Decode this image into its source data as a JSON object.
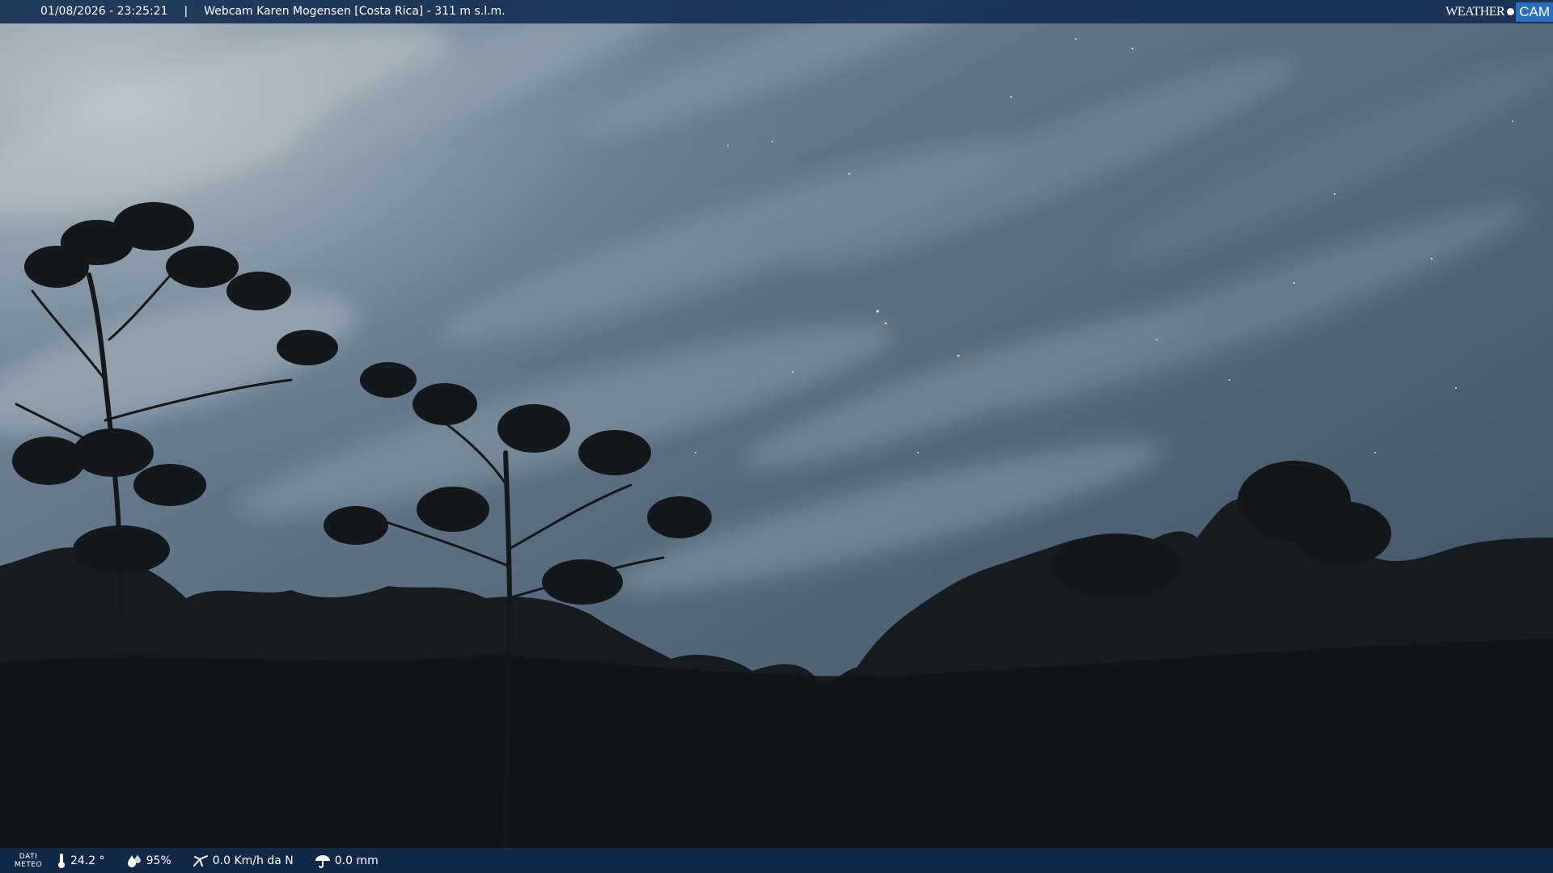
{
  "header": {
    "datetime": "01/08/2026 - 23:25:21",
    "separator": "|",
    "location": "Webcam Karen Mogensen [Costa Rica] - 311 m s.l.m."
  },
  "logo": {
    "weather": "WEATHER",
    "cam": "CAM"
  },
  "meteo": {
    "label_line1": "DATI",
    "label_line2": "METEO",
    "temperature": "24.2 °",
    "humidity": "95%",
    "wind": "0.0 Km/h da N",
    "rain": "0.0 mm"
  },
  "colors": {
    "bar_background": "#163052",
    "logo_accent": "#2a6fc2",
    "sky": "#5a6f80",
    "foliage": "#12181c"
  },
  "icons": {
    "temperature": "thermometer-icon",
    "humidity": "humidity-drop-icon",
    "wind": "wind-icon",
    "rain": "umbrella-icon"
  }
}
